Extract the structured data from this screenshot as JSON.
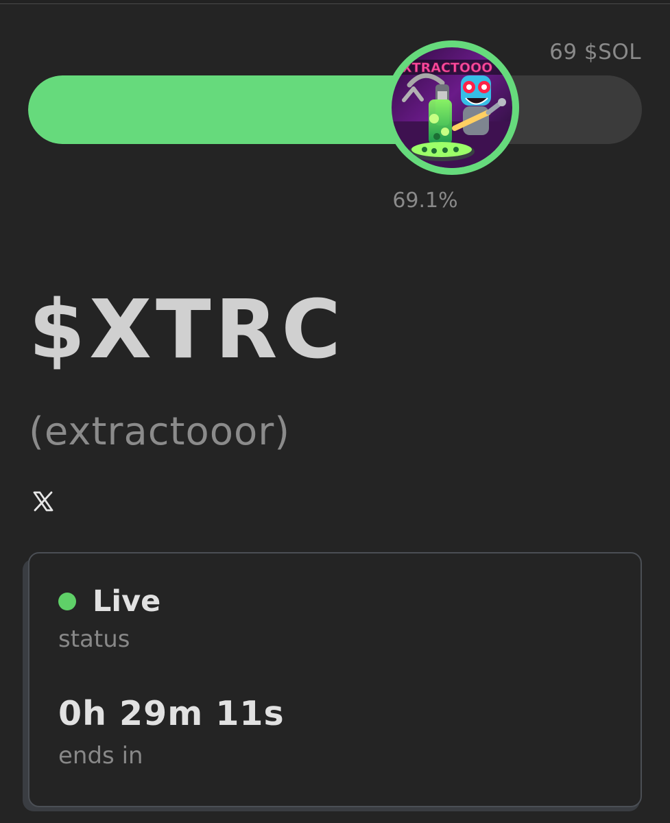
{
  "sale": {
    "goal_text": "69 $SOL",
    "progress_value": 69.1,
    "progress_text": "69.1%"
  },
  "token": {
    "ticker": "$XTRC",
    "name": "(extractooor)",
    "avatar_icon": "extractooor-logo",
    "avatar_text": "XTRACTOOO"
  },
  "links": {
    "x_icon": "x-logo-icon"
  },
  "status_card": {
    "status_value": "Live",
    "status_label": "status",
    "countdown_value": "0h 29m 11s",
    "countdown_label": "ends in"
  },
  "colors": {
    "page_background": "#242424",
    "progress_fill": "#66da7c",
    "progress_track": "#3b3b3b",
    "live_indicator": "#5fd068",
    "muted_text": "#8a8a8a",
    "primary_text": "#d6d6d6"
  }
}
